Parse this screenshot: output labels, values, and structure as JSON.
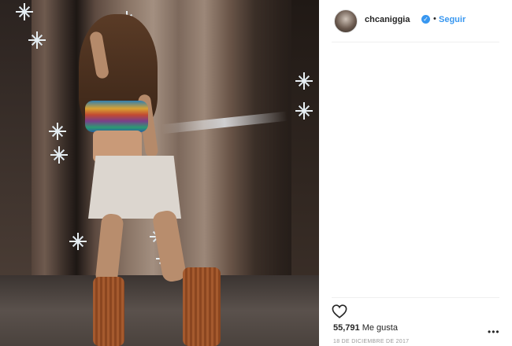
{
  "post": {
    "username": "chcaniggia",
    "separator": "•",
    "follow_label": "Seguir",
    "likes_count": "55,791",
    "likes_label": "Me gusta",
    "date": "18 DE DICIEMBRE DE 2017",
    "more_label": "•••"
  },
  "icons": {
    "verified": "verified-badge-icon",
    "heart": "heart-icon",
    "more": "more-options-icon"
  },
  "colors": {
    "accent": "#3897f0",
    "text": "#262626",
    "muted": "#999999"
  }
}
